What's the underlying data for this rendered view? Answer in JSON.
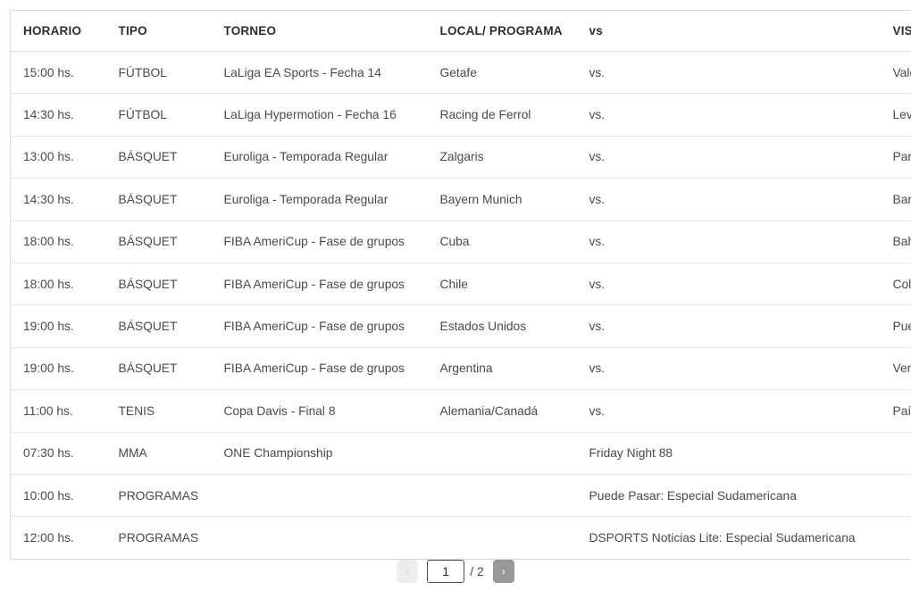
{
  "table": {
    "columns": [
      {
        "key": "horario",
        "label": "HORARIO"
      },
      {
        "key": "tipo",
        "label": "TIPO"
      },
      {
        "key": "torneo",
        "label": "TORNEO"
      },
      {
        "key": "local",
        "label": "LOCAL/ PROGRAMA"
      },
      {
        "key": "vs",
        "label": "vs"
      },
      {
        "key": "visitante",
        "label": "VISITANTE"
      }
    ],
    "rows": [
      {
        "horario": "15:00 hs.",
        "tipo": "FÚTBOL",
        "torneo": "LaLiga EA Sports - Fecha 14",
        "local": "Getafe",
        "vs": "vs.",
        "visitante": "Valencia"
      },
      {
        "horario": "14:30 hs.",
        "tipo": "FÚTBOL",
        "torneo": "LaLiga Hypermotion - Fecha 16",
        "local": "Racing de Ferrol",
        "vs": "vs.",
        "visitante": "Levante"
      },
      {
        "horario": "13:00 hs.",
        "tipo": "BÁSQUET",
        "torneo": "Euroliga - Temporada Regular",
        "local": "Zalgaris",
        "vs": "vs.",
        "visitante": "Partizan"
      },
      {
        "horario": "14:30 hs.",
        "tipo": "BÁSQUET",
        "torneo": "Euroliga - Temporada Regular",
        "local": "Bayern Munich",
        "vs": "vs.",
        "visitante": "Barcelona"
      },
      {
        "horario": "18:00 hs.",
        "tipo": "BÁSQUET",
        "torneo": "FIBA AmeriCup - Fase de grupos",
        "local": "Cuba",
        "vs": "vs.",
        "visitante": "Bahamas"
      },
      {
        "horario": "18:00 hs.",
        "tipo": "BÁSQUET",
        "torneo": "FIBA AmeriCup - Fase de grupos",
        "local": "Chile",
        "vs": "vs.",
        "visitante": "Colombia"
      },
      {
        "horario": "19:00 hs.",
        "tipo": "BÁSQUET",
        "torneo": "FIBA AmeriCup - Fase de grupos",
        "local": "Estados Unidos",
        "vs": "vs.",
        "visitante": "Puerto Rico"
      },
      {
        "horario": "19:00 hs.",
        "tipo": "BÁSQUET",
        "torneo": "FIBA AmeriCup - Fase de grupos",
        "local": "Argentina",
        "vs": "vs.",
        "visitante": "Venezuela"
      },
      {
        "horario": "11:00 hs.",
        "tipo": "TENIS",
        "torneo": "Copa Davis - Final 8",
        "local": "Alemania/Canadá",
        "vs": "vs.",
        "visitante": "País"
      },
      {
        "horario": "07:30 hs.",
        "tipo": "MMA",
        "torneo": "ONE Championship",
        "local": "",
        "vs": "Friday Night 88",
        "visitante": ""
      },
      {
        "horario": "10:00 hs.",
        "tipo": "PROGRAMAS",
        "torneo": "",
        "local": "",
        "vs": "Puede Pasar: Especial Sudamericana",
        "visitante": ""
      },
      {
        "horario": "12:00 hs.",
        "tipo": "PROGRAMAS",
        "torneo": "",
        "local": "",
        "vs": "DSPORTS Noticias Lite: Especial Sudamericana",
        "visitante": ""
      }
    ]
  },
  "pagination": {
    "prev_label": "‹",
    "next_label": "›",
    "current_page": "1",
    "total_label": "/ 2",
    "prev_disabled_color": "#ededed",
    "next_active_color": "#999999"
  }
}
